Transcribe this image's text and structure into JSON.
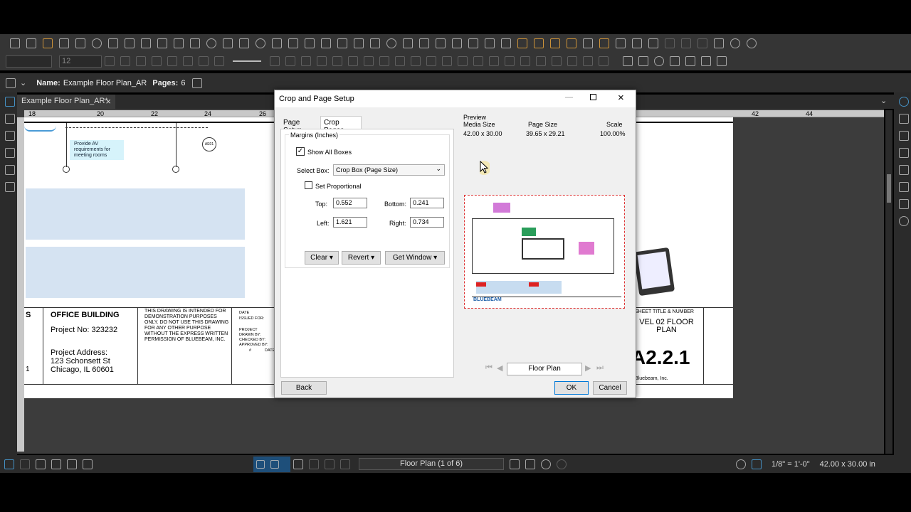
{
  "font_size": "12",
  "namebar": {
    "name_label": "Name:",
    "name_value": "Example Floor Plan_AR",
    "pages_label": "Pages:",
    "pages_value": "6"
  },
  "tab": {
    "label": "Example Floor Plan_AR*"
  },
  "ruler": {
    "ticks": [
      "18",
      "20",
      "22",
      "24",
      "26",
      "42",
      "44"
    ]
  },
  "drawing": {
    "callout": "Provide AV requirements for meeting rooms",
    "tag": "AE01",
    "title_block": {
      "edge": "S",
      "building": "OFFICE BUILDING",
      "project_no": "Project No: 323232",
      "address_label": "Project Address:",
      "address1": "123 Schonsett St",
      "address2": "Chicago, IL 60601",
      "edge_num": "1",
      "disclaimer": "THIS DRAWING IS INTENDED FOR DEMONSTRATION PURPOSES ONLY.  DO NOT USE THIS DRAWING FOR ANY OTHER PURPOSE WITHOUT THE EXPRESS WRITTEN PERMISSION OF BLUEBEAM, INC.",
      "date": "DATE",
      "issued": "ISSUED FOR:",
      "project": "PROJECT",
      "drawn": "DRAWN BY:",
      "checked": "CHECKED BY:",
      "approved": "APPROVED BY:",
      "num": "#",
      "date2": "DATE",
      "sheet_title_label": "SHEET TITLE & NUMBER",
      "sheet_title": "VEL 02 FLOOR PLAN",
      "sheet_number": "A2.2.1",
      "copyright": "Bluebeam, Inc."
    }
  },
  "dialog": {
    "title": "Crop and Page Setup",
    "tabs": [
      "Page Setup",
      "Crop Pages"
    ],
    "group_label": "Margins (Inches)",
    "show_all_boxes": "Show All Boxes",
    "select_box_label": "Select Box:",
    "select_box_value": "Crop Box (Page Size)",
    "set_proportional": "Set Proportional",
    "top_label": "Top:",
    "top_value": "0.552",
    "bottom_label": "Bottom:",
    "bottom_value": "0.241",
    "left_label": "Left:",
    "left_value": "1.621",
    "right_label": "Right:",
    "right_value": "0.734",
    "clear": "Clear",
    "revert": "Revert",
    "get_window": "Get Window",
    "preview_label": "Preview",
    "media_size_label": "Media Size",
    "media_size_value": "42.00 x 30.00",
    "page_size_label": "Page Size",
    "page_size_value": "39.65 x 29.21",
    "scale_label": "Scale",
    "scale_value": "100.00%",
    "preview_brand": "BLUEBEAM",
    "page_nav_value": "Floor Plan",
    "back": "Back",
    "ok": "OK",
    "cancel": "Cancel"
  },
  "status": {
    "page_nav": "Floor Plan (1 of 6)",
    "scale": "1/8\" = 1'-0\"",
    "size": "42.00 x 30.00 in"
  }
}
